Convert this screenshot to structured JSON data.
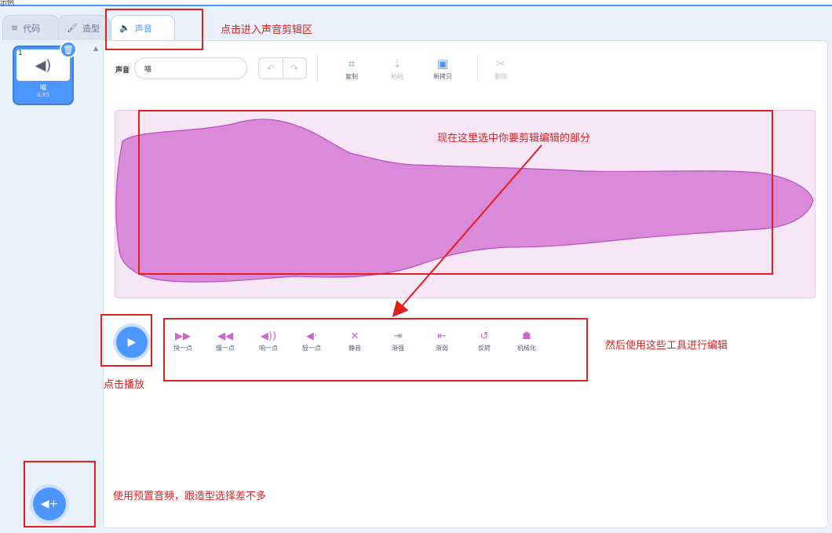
{
  "window": {
    "title": "示例"
  },
  "tabs": [
    {
      "label": "代码",
      "icon": "code-icon"
    },
    {
      "label": "造型",
      "icon": "brush-icon"
    },
    {
      "label": "声音",
      "icon": "speaker-icon"
    }
  ],
  "sound_list": [
    {
      "index": "1",
      "name": "喵",
      "duration": "0.85",
      "icon": "speaker-icon"
    }
  ],
  "editor": {
    "sound_label": "声音",
    "sound_name": "喵",
    "tools": [
      {
        "label": "复制",
        "icon": "copy-icon",
        "enabled": true
      },
      {
        "label": "粘贴",
        "icon": "paste-icon",
        "enabled": false
      },
      {
        "label": "新拷贝",
        "icon": "new-copy-icon",
        "enabled": true
      },
      {
        "label": "删除",
        "icon": "scissors-icon",
        "enabled": false
      }
    ],
    "effects": [
      {
        "label": "快一点",
        "icon": "faster-icon"
      },
      {
        "label": "慢一点",
        "icon": "slower-icon"
      },
      {
        "label": "响一点",
        "icon": "louder-icon"
      },
      {
        "label": "轻一点",
        "icon": "softer-icon"
      },
      {
        "label": "静音",
        "icon": "mute-icon"
      },
      {
        "label": "渐强",
        "icon": "fade-in-icon"
      },
      {
        "label": "渐弱",
        "icon": "fade-out-icon"
      },
      {
        "label": "反转",
        "icon": "reverse-icon"
      },
      {
        "label": "机械化",
        "icon": "robot-icon"
      }
    ]
  },
  "colors": {
    "accent": "#4c97ff",
    "sound_wave": "#cf63cf",
    "annotation": "#e01f1f"
  },
  "annotations": {
    "tab_note": "点击进入声音剪辑区",
    "wave_note": "现在这里选中你要剪辑编辑的部分",
    "effects_note": "然后使用这些工具进行编辑",
    "play_note": "点击播放",
    "add_note": "使用预置音频，跟造型选择差不多"
  }
}
